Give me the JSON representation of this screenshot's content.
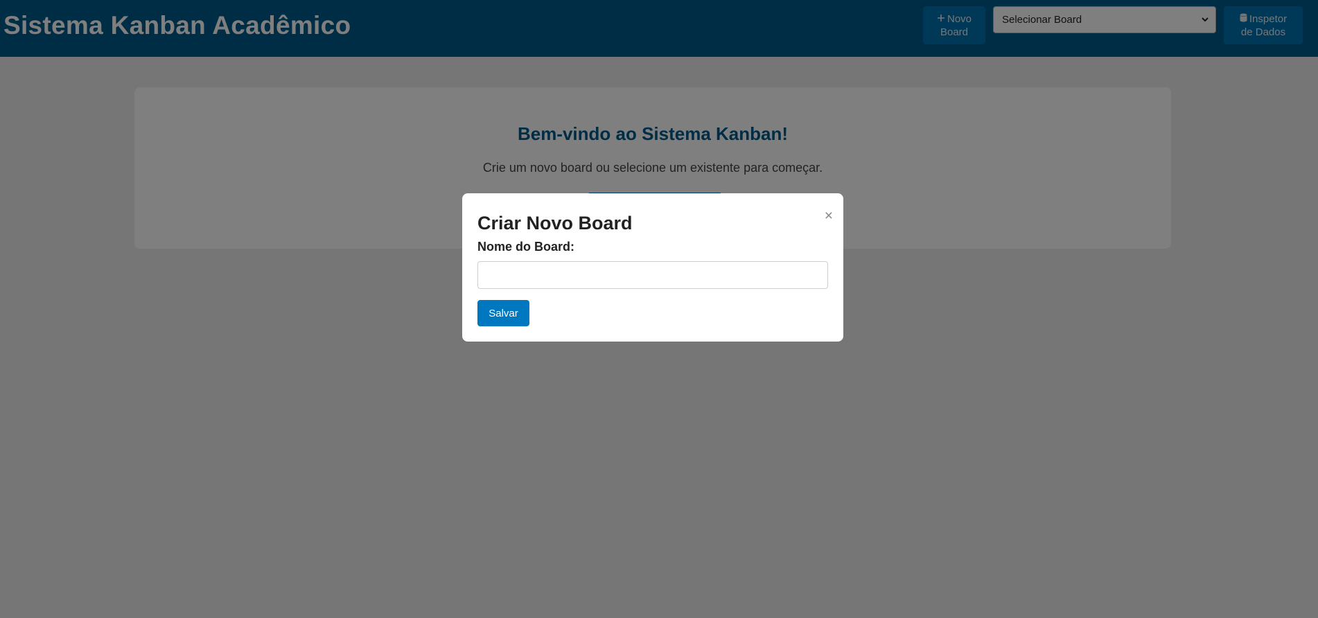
{
  "header": {
    "title": "Sistema Kanban Acadêmico",
    "new_board": {
      "icon": "plus-icon",
      "label_line1": "Novo",
      "label_line2": "Board"
    },
    "board_select": {
      "selected": "Selecionar Board"
    },
    "inspector": {
      "icon": "database-icon",
      "label_line1": "Inspetor",
      "label_line2": "de Dados"
    }
  },
  "welcome": {
    "title": "Bem-vindo ao Sistema Kanban!",
    "subtitle": "Crie um novo board ou selecione um existente para começar."
  },
  "modal": {
    "title": "Criar Novo Board",
    "close_glyph": "×",
    "field_label": "Nome do Board:",
    "field_value": "",
    "save_label": "Salvar"
  },
  "colors": {
    "header_bg": "#005a8c",
    "accent": "#0078c0",
    "overlay": "rgba(0,0,0,0.5)"
  }
}
